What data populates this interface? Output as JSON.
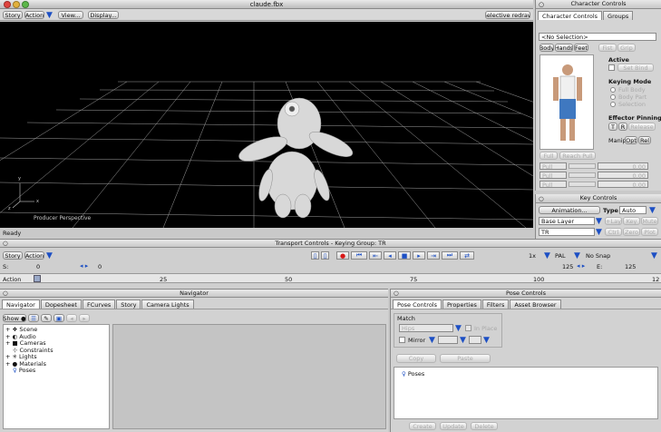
{
  "window": {
    "title": "claude.fbx"
  },
  "toolbar": {
    "story": "Story",
    "action": "Action",
    "view": "View...",
    "display": "Display...",
    "selective_redraw": "Selective redraw"
  },
  "viewport": {
    "camera_label": "Producer Perspective",
    "status": "Ready",
    "axis_y": "y",
    "axis_x": "x",
    "axis_z": "z"
  },
  "character_controls": {
    "title": "Character Controls",
    "tabs": [
      "Character Controls",
      "Groups"
    ],
    "selection": "<No Selection>",
    "body_tabs": [
      "Body",
      "Hands",
      "Feet",
      "Fist",
      "Grip"
    ],
    "active_label": "Active",
    "active_btn": "Set Bind",
    "keying_mode_label": "Keying Mode",
    "keying_modes": [
      "Full Body",
      "Body Part",
      "Selection"
    ],
    "effector_pinning_label": "Effector Pinning",
    "pin_btns": [
      "T",
      "R",
      "Release"
    ],
    "manip_label": "Manip",
    "manip_btns": [
      "Opt",
      "Rel"
    ],
    "reach_btns": [
      "Full",
      "Reach Pull"
    ],
    "slider_rows": [
      {
        "label": "Pull",
        "value": "0.00"
      },
      {
        "label": "Pull",
        "value": "0.00"
      },
      {
        "label": "Pull",
        "value": "0.00"
      }
    ]
  },
  "key_controls": {
    "title": "Key Controls",
    "animation": "Animation...",
    "type_label": "Type",
    "type_value": "Auto",
    "layer": "Base Layer",
    "layer_btns": [
      "+Lay",
      "Key",
      "Mute"
    ],
    "tr": "TR",
    "tr_btns": [
      "Ctrl",
      "Zero",
      "Plot"
    ]
  },
  "transport": {
    "title": "Transport Controls  -  Keying Group: TR",
    "story": "Story",
    "action": "Action",
    "s_label": "S:",
    "s_value": "0",
    "start_frame": "0",
    "rate": "1x",
    "format": "PAL",
    "snap": "No Snap",
    "end_display": "125",
    "e_label": "E:",
    "e_value": "125",
    "timeline_label": "Action",
    "timeline_ticks": [
      "25",
      "50",
      "75",
      "100",
      "12"
    ]
  },
  "navigator": {
    "title": "Navigator",
    "tabs": [
      "Navigator",
      "Dopesheet",
      "FCurves",
      "Story",
      "Camera Lights"
    ],
    "show": "Show",
    "tree": [
      {
        "label": "Scene",
        "icon": "scene-icon"
      },
      {
        "label": "Audio",
        "icon": "audio-icon"
      },
      {
        "label": "Cameras",
        "icon": "camera-icon"
      },
      {
        "label": "Constraints",
        "icon": "constraint-icon"
      },
      {
        "label": "Lights",
        "icon": "light-icon"
      },
      {
        "label": "Materials",
        "icon": "material-icon"
      },
      {
        "label": "Poses",
        "icon": "pose-icon"
      }
    ]
  },
  "pose_controls": {
    "title": "Pose Controls",
    "tabs": [
      "Pose Controls",
      "Properties",
      "Filters",
      "Asset Browser"
    ],
    "match_label": "Match",
    "match_value": "Hips",
    "in_place": "In Place",
    "mirror_label": "Mirror",
    "copy": "Copy",
    "paste": "Paste",
    "list_item": "Poses",
    "bottom_btns": [
      "Create",
      "Update",
      "Delete"
    ]
  },
  "colors": {
    "accent": "#1c4fc4",
    "record": "#d81818",
    "viewport_bg": "#000000"
  }
}
